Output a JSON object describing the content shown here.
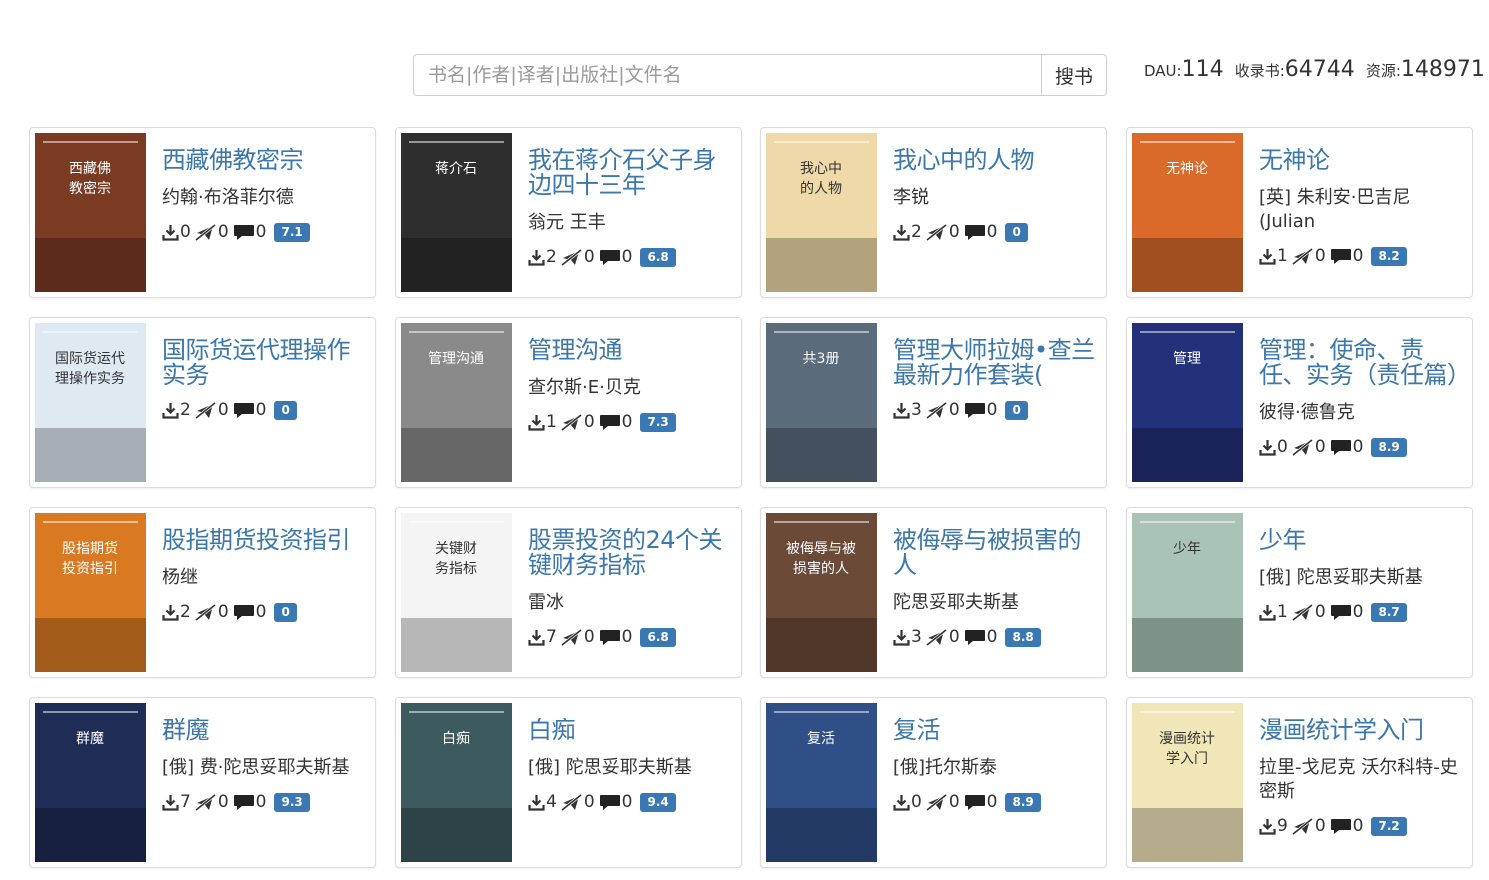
{
  "search": {
    "placeholder": "书名|作者|译者|出版社|文件名",
    "value": "",
    "button_label": "搜书"
  },
  "stats": {
    "dau_label": "DAU:",
    "dau_value": "114",
    "books_label": "收录书:",
    "books_value": "64744",
    "res_label": "资源:",
    "res_value": "148971"
  },
  "books": [
    {
      "title": "西藏佛教密宗",
      "author": "约翰·布洛菲尔德",
      "downloads": "0",
      "shares": "0",
      "comments": "0",
      "rating": "7.1",
      "cover_text": "西藏佛教密宗",
      "cover_color": "#7b3a22"
    },
    {
      "title": "我在蒋介石父子身边四十三年",
      "author": "翁元 王丰",
      "downloads": "2",
      "shares": "0",
      "comments": "0",
      "rating": "6.8",
      "cover_text": "蒋介石",
      "cover_color": "#2e2e2e"
    },
    {
      "title": "我心中的人物",
      "author": "李锐",
      "downloads": "2",
      "shares": "0",
      "comments": "0",
      "rating": "0",
      "cover_text": "我心中的人物",
      "cover_color": "#efd9a8"
    },
    {
      "title": "无神论",
      "author": "[英] 朱利安·巴吉尼 (Julian",
      "downloads": "1",
      "shares": "0",
      "comments": "0",
      "rating": "8.2",
      "cover_text": "无神论",
      "cover_color": "#d96a2a"
    },
    {
      "title": "国际货运代理操作实务",
      "author": "",
      "downloads": "2",
      "shares": "0",
      "comments": "0",
      "rating": "0",
      "cover_text": "国际货运代理操作实务",
      "cover_color": "#dfe9f2"
    },
    {
      "title": "管理沟通",
      "author": "查尔斯·E·贝克",
      "downloads": "1",
      "shares": "0",
      "comments": "0",
      "rating": "7.3",
      "cover_text": "管理沟通",
      "cover_color": "#8a8a8a"
    },
    {
      "title": "管理大师拉姆•查兰最新力作套装(",
      "author": "",
      "downloads": "3",
      "shares": "0",
      "comments": "0",
      "rating": "0",
      "cover_text": "共3册",
      "cover_color": "#5a6b7c"
    },
    {
      "title": "管理：使命、责任、实务（责任篇）",
      "author": "彼得·德鲁克",
      "downloads": "0",
      "shares": "0",
      "comments": "0",
      "rating": "8.9",
      "cover_text": "管理",
      "cover_color": "#23317a"
    },
    {
      "title": "股指期货投资指引",
      "author": "杨继",
      "downloads": "2",
      "shares": "0",
      "comments": "0",
      "rating": "0",
      "cover_text": "股指期货投资指引",
      "cover_color": "#d97a22"
    },
    {
      "title": "股票投资的24个关键财务指标",
      "author": "雷冰",
      "downloads": "7",
      "shares": "0",
      "comments": "0",
      "rating": "6.8",
      "cover_text": "关键财务指标",
      "cover_color": "#f4f4f4"
    },
    {
      "title": "被侮辱与被损害的人",
      "author": "陀思妥耶夫斯基",
      "downloads": "3",
      "shares": "0",
      "comments": "0",
      "rating": "8.8",
      "cover_text": "被侮辱与被损害的人",
      "cover_color": "#6b4a38"
    },
    {
      "title": "少年",
      "author": "[俄] 陀思妥耶夫斯基",
      "downloads": "1",
      "shares": "0",
      "comments": "0",
      "rating": "8.7",
      "cover_text": "少年",
      "cover_color": "#a9c4b6"
    },
    {
      "title": "群魔",
      "author": "[俄] 费·陀思妥耶夫斯基",
      "downloads": "7",
      "shares": "0",
      "comments": "0",
      "rating": "9.3",
      "cover_text": "群魔",
      "cover_color": "#1f2c55"
    },
    {
      "title": "白痴",
      "author": "[俄] 陀思妥耶夫斯基",
      "downloads": "4",
      "shares": "0",
      "comments": "0",
      "rating": "9.4",
      "cover_text": "白痴",
      "cover_color": "#3d5a5e"
    },
    {
      "title": "复活",
      "author": "[俄]托尔斯泰",
      "downloads": "0",
      "shares": "0",
      "comments": "0",
      "rating": "8.9",
      "cover_text": "复活",
      "cover_color": "#2f4f86"
    },
    {
      "title": "漫画统计学入门",
      "author": "拉里-戈尼克 沃尔科特-史密斯",
      "downloads": "9",
      "shares": "0",
      "comments": "0",
      "rating": "7.2",
      "cover_text": "漫画统计学入门",
      "cover_color": "#f1e6b8"
    }
  ]
}
